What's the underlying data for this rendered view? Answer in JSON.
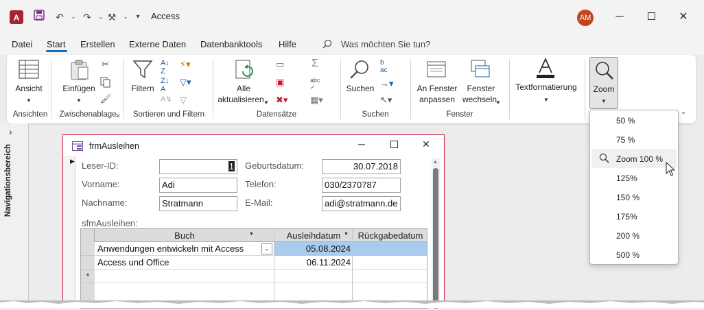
{
  "window": {
    "title": "Access",
    "avatar": "AM"
  },
  "quick_access": {
    "app_icon": "A"
  },
  "menu": [
    "Datei",
    "Start",
    "Erstellen",
    "Externe Daten",
    "Datenbanktools",
    "Hilfe"
  ],
  "search": {
    "placeholder": "Was möchten Sie tun?"
  },
  "ribbon": {
    "ansicht": "Ansicht",
    "einfuegen": "Einfügen",
    "filtern": "Filtern",
    "alle": "Alle",
    "aktualisieren": "aktualisieren",
    "suchen": "Suchen",
    "an_fenster": "An Fenster",
    "anpassen": "anpassen",
    "fenster": "Fenster",
    "wechseln": "wechseln",
    "textformatierung": "Textformatierung",
    "zoom": "Zoom",
    "groups": {
      "ansichten": "Ansichten",
      "zwischenablage": "Zwischenablage",
      "sortieren": "Sortieren und Filtern",
      "datensaetze": "Datensätze",
      "suchen": "Suchen",
      "fenster": "Fenster"
    }
  },
  "nav_pane": {
    "label": "Navigationsbereich"
  },
  "form": {
    "title": "frmAusleihen",
    "fields": {
      "leser_id_label": "Leser-ID:",
      "leser_id_value": "1",
      "vorname_label": "Vorname:",
      "vorname_value": "Adi",
      "nachname_label": "Nachname:",
      "nachname_value": "Stratmann",
      "geburtsdatum_label": "Geburtsdatum:",
      "geburtsdatum_value": "30.07.2018",
      "telefon_label": "Telefon:",
      "telefon_value": "030/2370787",
      "email_label": "E-Mail:",
      "email_value": "adi@stratmann.de"
    },
    "subform_label": "sfmAusleihen:",
    "table": {
      "headers": [
        "Buch",
        "Ausleihdatum",
        "Rückgabedatum"
      ],
      "rows": [
        [
          "Anwendungen entwickeln mit Access",
          "05.08.2024",
          ""
        ],
        [
          "Access und Office",
          "06.11.2024",
          ""
        ]
      ],
      "new_row_marker": "*"
    }
  },
  "zoom_menu": {
    "items": [
      "50 %",
      "75 %",
      "Zoom 100 %",
      "125%",
      "150 %",
      "175%",
      "200 %",
      "500 %"
    ]
  },
  "colors": {
    "accent": "#0f6cbd",
    "form_border": "#c9183b",
    "selection": "#a9cbee",
    "access_red": "#a4262c"
  }
}
